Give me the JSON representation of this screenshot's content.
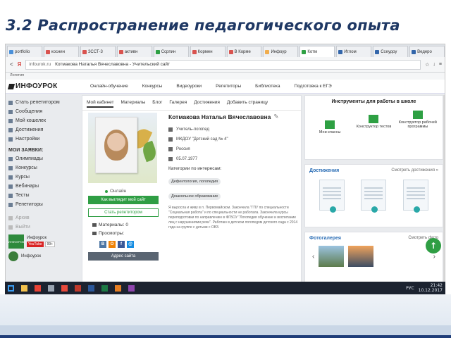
{
  "slide": {
    "title": "3.2 Распространение педагогического опыта"
  },
  "browser": {
    "tabs": [
      {
        "label": "portfolio",
        "color": "#4a90d9"
      },
      {
        "label": "коснин",
        "color": "#d9534f"
      },
      {
        "label": "ЗССТ-3",
        "color": "#d9534f"
      },
      {
        "label": "активн",
        "color": "#d9534f"
      },
      {
        "label": "Ссрпин",
        "color": "#2ea043"
      },
      {
        "label": "Кормен",
        "color": "#d9534f"
      },
      {
        "label": "В Корме",
        "color": "#d9534f"
      },
      {
        "label": "Инфоур",
        "color": "#f0ad4e"
      },
      {
        "label": "Котм",
        "color": "#2ea043"
      },
      {
        "label": "Иглом",
        "color": "#3366aa"
      },
      {
        "label": "Ссеудоу",
        "color": "#3366aa"
      },
      {
        "label": "Ведеро",
        "color": "#3366aa"
      }
    ],
    "nav_back": "<",
    "nav_reload": "Я",
    "domain": "infourok.ru",
    "page_title": "Котмакова Наталья Вячеславовна - Учительский сайт",
    "right_icons": [
      "☆",
      "↓",
      "≡"
    ],
    "bookmarks": "Логотип"
  },
  "site": {
    "logo": "ИНФОУРОК",
    "menu": [
      "Онлайн-обучение",
      "Конкурсы",
      "Видеоуроки",
      "Репетиторы",
      "Библиотека",
      "Подготовка к ЕГЭ"
    ]
  },
  "sidebar": {
    "items": [
      "Стать репетитором",
      "Сообщения",
      "Мой кошелек",
      "Достижения",
      "Настройки"
    ],
    "header": "МОИ ЗАЯВКИ:",
    "requests": [
      "Олимпиады",
      "Конкурсы",
      "Курсы",
      "Вебинары",
      "Тесты",
      "Репетиторы"
    ],
    "muted": [
      "Архив",
      "Выйти"
    ],
    "info_thumb": "ИНФОУРОК",
    "info_name": "Инфоурок",
    "youtube": "YouTube",
    "count": "99+",
    "info2": "Инфоурок"
  },
  "profile": {
    "tabs": [
      "Мой кабинет",
      "Материалы",
      "Блог",
      "Галерея",
      "Достижения",
      "Добавить страницу"
    ],
    "online": "Онлайн",
    "btn_site": "Как выглядит мой сайт",
    "btn_tutor": "Стать репетитором",
    "materials_label": "Материалы: 0",
    "views_label": "Просмотры:",
    "social": [
      {
        "letter": "В",
        "color": "#4c75a3"
      },
      {
        "letter": "О",
        "color": "#ee8208"
      },
      {
        "letter": "f",
        "color": "#3b5998"
      },
      {
        "letter": "@",
        "color": "#168de2"
      }
    ],
    "btn_address": "Адрес сайта",
    "name": "Котмакова Наталья Вячеславовна",
    "edit_icon": "✎",
    "rows": [
      "Учитель-логопед",
      "МКДОУ \"Детский сад № 4\"",
      "Россия",
      "05.07.1977"
    ],
    "interests_label": "Категории по интересам:",
    "chips": [
      "Дефектология, логопедия",
      "Дошкольное образование"
    ],
    "about": "Я выросла и живу в п. Первомайском. Закончила \"ГПУ по специальности \"Социальная работа\" и по специальности не работала. Закончила курсы переподготовки по направлению в ФГБОУ \"Логопедия обучение и воспитание лиц с нарушениями речи\". Работаю в детском логопедом детского сада с 2014 года на группе с детьми с ОВЗ."
  },
  "widgets": {
    "tools_title": "Инструменты для работы в школе",
    "tools": [
      "Мои классы",
      "Конструктор тестов",
      "Конструктор рабочей программы"
    ],
    "achievements_title": "Достижения",
    "achievements_link": "Смотреть достижения »",
    "gallery_title": "Фотогалерея",
    "gallery_link": "Смотреть фото",
    "prev": "‹",
    "next": "›",
    "up": "↑"
  },
  "taskbar": {
    "icons": [
      {
        "name": "start",
        "color": "#3b9cf2"
      },
      {
        "name": "explorer",
        "color": "#f2c14e"
      },
      {
        "name": "chrome",
        "color": "#e94235"
      },
      {
        "name": "media",
        "color": "#9aa4b2"
      },
      {
        "name": "yandex",
        "color": "#e84a3c"
      },
      {
        "name": "opera",
        "color": "#c0392b"
      },
      {
        "name": "word",
        "color": "#2b579a"
      },
      {
        "name": "excel",
        "color": "#1d7a45"
      },
      {
        "name": "paint",
        "color": "#e67e22"
      },
      {
        "name": "app",
        "color": "#8e44ad"
      }
    ],
    "lang": "РУС",
    "time": "21:42",
    "date": "10.12.2017"
  }
}
